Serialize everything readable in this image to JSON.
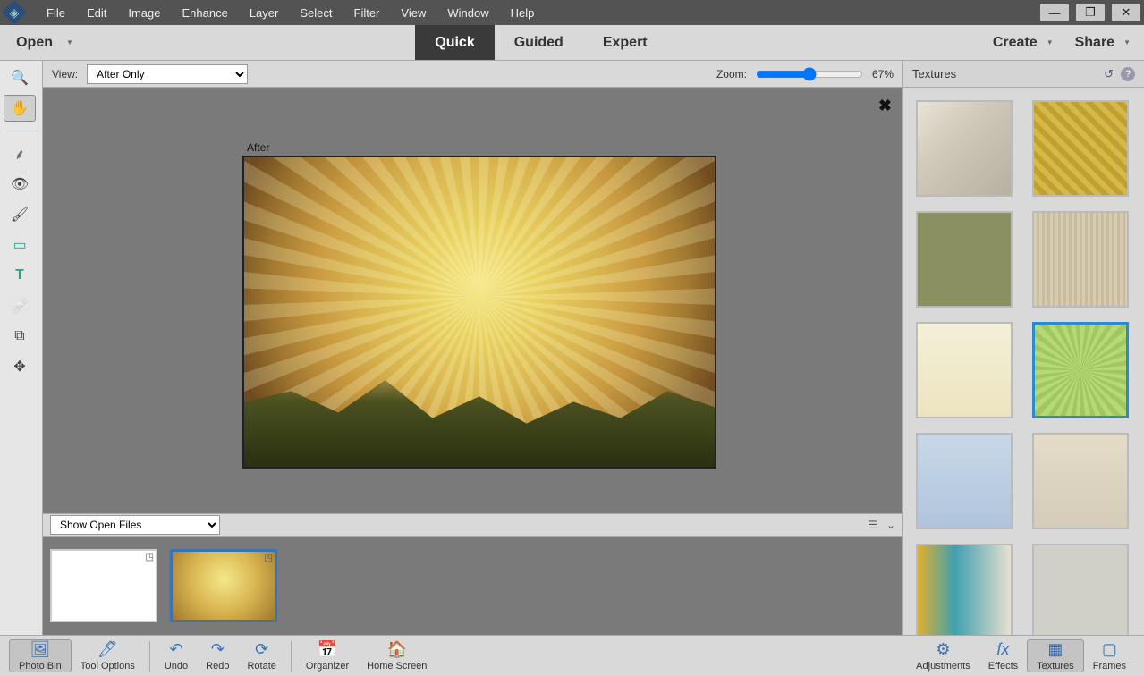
{
  "menu": {
    "items": [
      "File",
      "Edit",
      "Image",
      "Enhance",
      "Layer",
      "Select",
      "Filter",
      "View",
      "Window",
      "Help"
    ]
  },
  "openLabel": "Open",
  "modes": {
    "quick": "Quick",
    "guided": "Guided",
    "expert": "Expert",
    "active": "Quick"
  },
  "createLabel": "Create",
  "shareLabel": "Share",
  "view": {
    "label": "View:",
    "selected": "After Only"
  },
  "zoom": {
    "label": "Zoom:",
    "value": "67%"
  },
  "canvas": {
    "afterLabel": "After"
  },
  "bin": {
    "drop": "Show Open Files"
  },
  "rightPanel": {
    "title": "Textures"
  },
  "bottom": {
    "photoBin": "Photo Bin",
    "toolOptions": "Tool Options",
    "undo": "Undo",
    "redo": "Redo",
    "rotate": "Rotate",
    "organizer": "Organizer",
    "homeScreen": "Home Screen",
    "adjustments": "Adjustments",
    "effects": "Effects",
    "textures": "Textures",
    "frames": "Frames"
  },
  "textures": [
    {
      "bg": "linear-gradient(135deg,#e8e4d8,#d0c8b8 40%,#b8b0a0)"
    },
    {
      "bg": "repeating-linear-gradient(45deg,#d4b848,#d4b848 6px,#c0a030 6px,#c0a030 12px)"
    },
    {
      "bg": "#8a9060"
    },
    {
      "bg": "repeating-linear-gradient(90deg,#d8ccb0,#d8ccb0 3px,#c8bca0 3px,#c8bca0 6px)"
    },
    {
      "bg": "linear-gradient(#f4f0d8,#ece4c0)"
    },
    {
      "bg": "repeating-conic-gradient(from 0deg at 50% 50%, #b8d878 0deg 6deg, #a0c860 6deg 12deg)",
      "selected": true
    },
    {
      "bg": "linear-gradient(#c8d8e8,#b0c4dc)"
    },
    {
      "bg": "linear-gradient(#e4dcc8,#d4ccb8)"
    },
    {
      "bg": "linear-gradient(90deg,#e0b030,#40a0b0 40%,#e8e0d0)"
    },
    {
      "bg": "#d0d0c8"
    }
  ]
}
